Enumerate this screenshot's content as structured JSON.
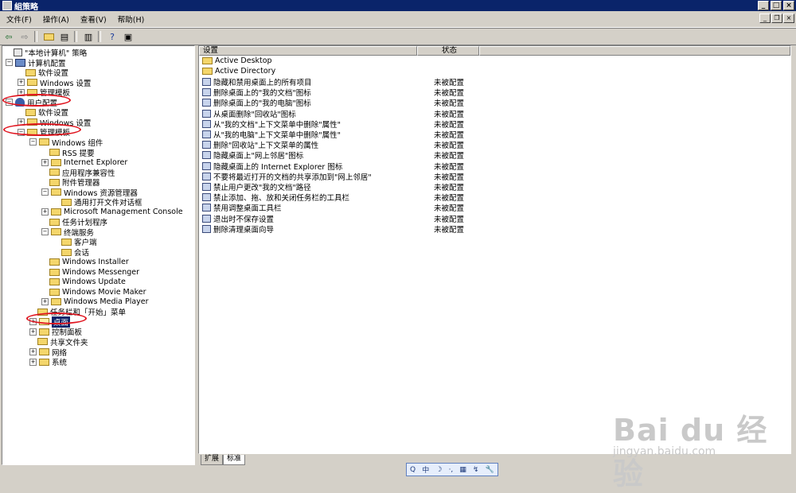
{
  "window": {
    "title": "組策略"
  },
  "window_buttons": [
    "_",
    "□",
    "×"
  ],
  "mdi_buttons": [
    "_",
    "❐",
    "×"
  ],
  "menu": [
    {
      "label": "文件(F)"
    },
    {
      "label": "操作(A)"
    },
    {
      "label": "查看(V)"
    },
    {
      "label": "帮助(H)"
    }
  ],
  "toolbar": {
    "back_icon": "back-arrow-icon",
    "forward_icon": "forward-arrow-icon",
    "up_icon": "up-folder-icon",
    "show_tree_icon": "show-tree-icon",
    "export_icon": "export-list-icon",
    "help_icon": "help-icon",
    "properties_icon": "properties-icon"
  },
  "tree": [
    {
      "label": "\"本地计算机\" 策略",
      "level": 0,
      "expander": "",
      "icon": "doc"
    },
    {
      "label": "计算机配置",
      "level": 0,
      "expander": "−",
      "icon": "pc"
    },
    {
      "label": "软件设置",
      "level": 1,
      "expander": "",
      "icon": "folder"
    },
    {
      "label": "Windows 设置",
      "level": 1,
      "expander": "+",
      "icon": "folder"
    },
    {
      "label": "管理模板",
      "level": 1,
      "expander": "+",
      "icon": "folder"
    },
    {
      "label": "用户配置",
      "level": 0,
      "expander": "−",
      "icon": "user"
    },
    {
      "label": "软件设置",
      "level": 1,
      "expander": "",
      "icon": "folder"
    },
    {
      "label": "Windows 设置",
      "level": 1,
      "expander": "+",
      "icon": "folder"
    },
    {
      "label": "管理模板",
      "level": 1,
      "expander": "−",
      "icon": "folder"
    },
    {
      "label": "Windows 组件",
      "level": 2,
      "expander": "−",
      "icon": "folder"
    },
    {
      "label": "RSS 提要",
      "level": 3,
      "expander": "",
      "icon": "folder"
    },
    {
      "label": "Internet Explorer",
      "level": 3,
      "expander": "+",
      "icon": "folder"
    },
    {
      "label": "应用程序兼容性",
      "level": 3,
      "expander": "",
      "icon": "folder"
    },
    {
      "label": "附件管理器",
      "level": 3,
      "expander": "",
      "icon": "folder"
    },
    {
      "label": "Windows 资源管理器",
      "level": 3,
      "expander": "−",
      "icon": "folder"
    },
    {
      "label": "通用打开文件对话框",
      "level": 4,
      "expander": "",
      "icon": "folder"
    },
    {
      "label": "Microsoft Management Console",
      "level": 3,
      "expander": "+",
      "icon": "folder"
    },
    {
      "label": "任务计划程序",
      "level": 3,
      "expander": "",
      "icon": "folder"
    },
    {
      "label": "终端服务",
      "level": 3,
      "expander": "−",
      "icon": "folder"
    },
    {
      "label": "客户端",
      "level": 4,
      "expander": "",
      "icon": "folder"
    },
    {
      "label": "会话",
      "level": 4,
      "expander": "",
      "icon": "folder"
    },
    {
      "label": "Windows Installer",
      "level": 3,
      "expander": "",
      "icon": "folder"
    },
    {
      "label": "Windows Messenger",
      "level": 3,
      "expander": "",
      "icon": "folder"
    },
    {
      "label": "Windows Update",
      "level": 3,
      "expander": "",
      "icon": "folder"
    },
    {
      "label": "Windows Movie Maker",
      "level": 3,
      "expander": "",
      "icon": "folder"
    },
    {
      "label": "Windows Media Player",
      "level": 3,
      "expander": "+",
      "icon": "folder"
    },
    {
      "label": "任务栏和「开始」菜单",
      "level": 2,
      "expander": "",
      "icon": "folder"
    },
    {
      "label": "桌面",
      "level": 2,
      "expander": "+",
      "icon": "folder-open",
      "selected": true
    },
    {
      "label": "控制面板",
      "level": 2,
      "expander": "+",
      "icon": "folder"
    },
    {
      "label": "共享文件夹",
      "level": 2,
      "expander": "",
      "icon": "folder"
    },
    {
      "label": "网络",
      "level": 2,
      "expander": "+",
      "icon": "folder"
    },
    {
      "label": "系统",
      "level": 2,
      "expander": "+",
      "icon": "folder"
    }
  ],
  "list": {
    "columns": [
      "设置",
      "状态"
    ],
    "rows": [
      {
        "name": "Active Desktop",
        "state": "",
        "icon": "folder"
      },
      {
        "name": "Active Directory",
        "state": "",
        "icon": "folder"
      },
      {
        "name": "隐藏和禁用桌面上的所有项目",
        "state": "未被配置",
        "icon": "setting"
      },
      {
        "name": "删除桌面上的\"我的文档\"图标",
        "state": "未被配置",
        "icon": "setting"
      },
      {
        "name": "删除桌面上的\"我的电脑\"图标",
        "state": "未被配置",
        "icon": "setting"
      },
      {
        "name": "从桌面删除\"回收站\"图标",
        "state": "未被配置",
        "icon": "setting"
      },
      {
        "name": "从\"我的文档\"上下文菜单中删除\"属性\"",
        "state": "未被配置",
        "icon": "setting"
      },
      {
        "name": "从\"我的电脑\"上下文菜单中删除\"属性\"",
        "state": "未被配置",
        "icon": "setting"
      },
      {
        "name": "删除\"回收站\"上下文菜单的属性",
        "state": "未被配置",
        "icon": "setting"
      },
      {
        "name": "隐藏桌面上\"网上邻居\"图标",
        "state": "未被配置",
        "icon": "setting"
      },
      {
        "name": "隐藏桌面上的 Internet Explorer 图标",
        "state": "未被配置",
        "icon": "setting"
      },
      {
        "name": "不要将最近打开的文档的共享添加到\"网上邻居\"",
        "state": "未被配置",
        "icon": "setting"
      },
      {
        "name": "禁止用户更改\"我的文档\"路径",
        "state": "未被配置",
        "icon": "setting"
      },
      {
        "name": "禁止添加、拖、放和关闭任务栏的工具栏",
        "state": "未被配置",
        "icon": "setting"
      },
      {
        "name": "禁用调整桌面工具栏",
        "state": "未被配置",
        "icon": "setting"
      },
      {
        "name": "退出时不保存设置",
        "state": "未被配置",
        "icon": "setting"
      },
      {
        "name": "删除清理桌面向导",
        "state": "未被配置",
        "icon": "setting"
      }
    ]
  },
  "tabs": [
    {
      "label": "扩展"
    },
    {
      "label": "标准",
      "active": true
    }
  ],
  "ime_bar": [
    "Q",
    "中",
    "☽",
    "·,",
    "▦",
    "↯",
    "🔧"
  ],
  "watermark": {
    "text": "Bai du 经验",
    "url": "jingyan.baidu.com"
  },
  "annotation_color": "#e0141e"
}
